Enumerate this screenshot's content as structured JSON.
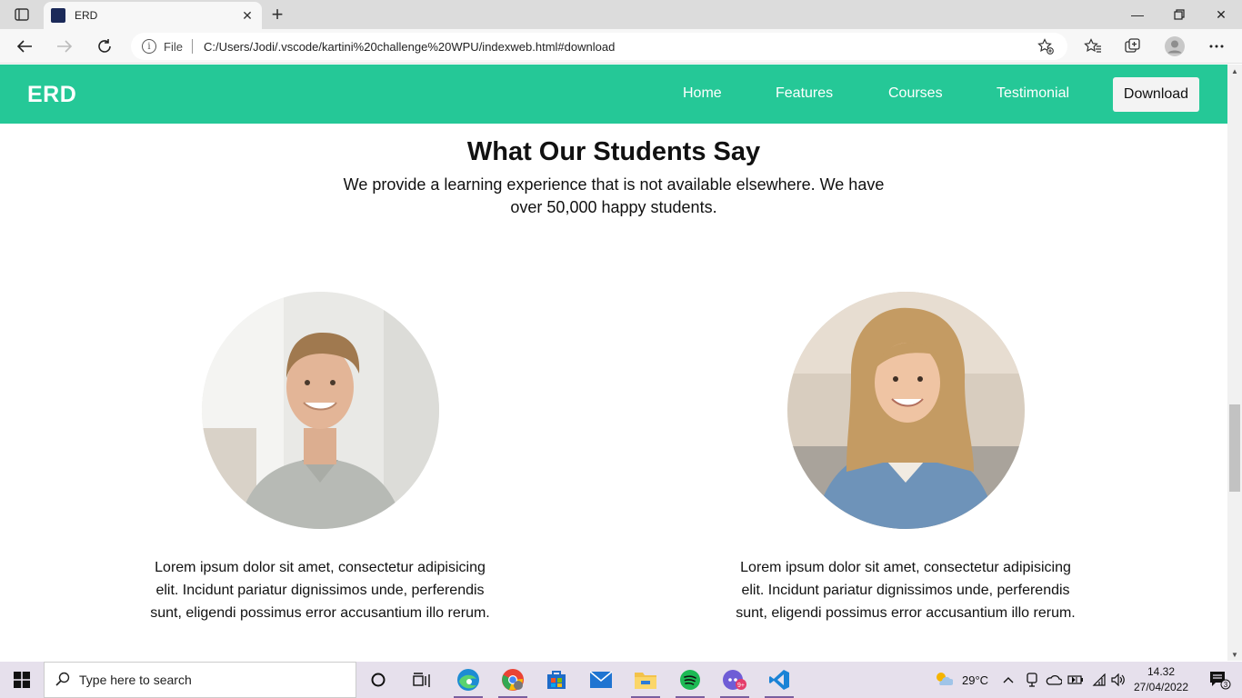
{
  "browser": {
    "tab_title": "ERD",
    "address_scheme": "File",
    "address_url": "C:/Users/Jodi/.vscode/kartini%20challenge%20WPU/indexweb.html#download"
  },
  "site": {
    "brand": "ERD",
    "nav": [
      {
        "label": "Home"
      },
      {
        "label": "Features"
      },
      {
        "label": "Courses"
      },
      {
        "label": "Testimonial"
      }
    ],
    "download_label": "Download"
  },
  "testimonials": {
    "title": "What Our Students Say",
    "subtitle": "We provide a learning experience that is not available elsewhere. We have over 50,000 happy students.",
    "items": [
      {
        "avatar": "student-male-photo",
        "text": "Lorem ipsum dolor sit amet, consectetur adipisicing elit. Incidunt pariatur dignissimos unde, perferendis sunt, eligendi possimus error accusantium illo rerum."
      },
      {
        "avatar": "student-female-photo",
        "text": "Lorem ipsum dolor sit amet, consectetur adipisicing elit. Incidunt pariatur dignissimos unde, perferendis sunt, eligendi possimus error accusantium illo rerum."
      }
    ]
  },
  "taskbar": {
    "search_placeholder": "Type here to search",
    "weather": "29°C",
    "time": "14.32",
    "date": "27/04/2022",
    "notification_count": "3"
  },
  "colors": {
    "brand_green": "#25c897",
    "taskbar": "#e6e0ec"
  }
}
